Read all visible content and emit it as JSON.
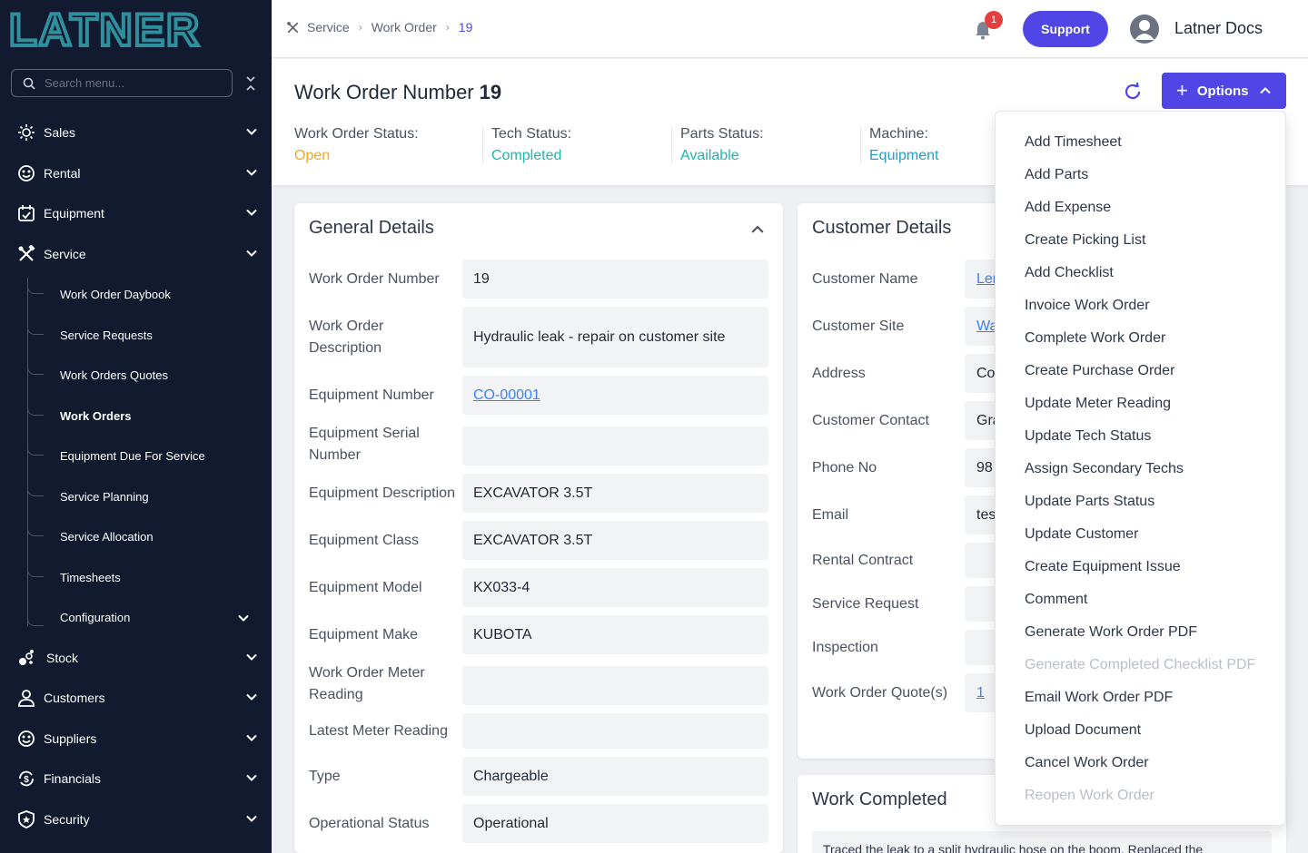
{
  "brand": {
    "logo_text": "LATNER"
  },
  "sidebar": {
    "search_placeholder": "Search menu...",
    "items": [
      {
        "label": "Sales",
        "icon": "sales-icon"
      },
      {
        "label": "Rental",
        "icon": "rental-icon"
      },
      {
        "label": "Equipment",
        "icon": "equipment-icon"
      },
      {
        "label": "Service",
        "icon": "service-icon"
      },
      {
        "label": "Stock",
        "icon": "stock-icon"
      },
      {
        "label": "Customers",
        "icon": "customers-icon"
      },
      {
        "label": "Suppliers",
        "icon": "suppliers-icon"
      },
      {
        "label": "Financials",
        "icon": "financials-icon"
      },
      {
        "label": "Security",
        "icon": "security-icon"
      }
    ],
    "service_sub": [
      "Work Order Daybook",
      "Service Requests",
      "Work Orders Quotes",
      "Work Orders",
      "Equipment Due For Service",
      "Service Planning",
      "Service Allocation",
      "Timesheets",
      "Configuration"
    ]
  },
  "header": {
    "breadcrumb": [
      "Service",
      "Work Order",
      "19"
    ],
    "notification_count": "1",
    "support_label": "Support",
    "user_name": "Latner Docs"
  },
  "page": {
    "title": "Work Order Number",
    "number": "19",
    "statuses": [
      {
        "label": "Work Order Status:",
        "value": "Open",
        "color": "#f5a623"
      },
      {
        "label": "Tech Status:",
        "value": "Completed",
        "color": "#1fb5ad"
      },
      {
        "label": "Parts Status:",
        "value": "Available",
        "color": "#1fb5ad"
      },
      {
        "label": "Machine:",
        "value": "Equipment",
        "color": "#1fa0c8"
      }
    ],
    "options_label": "Options"
  },
  "general": {
    "title": "General Details",
    "rows": [
      {
        "label": "Work Order Number",
        "value": "19"
      },
      {
        "label": "Work Order Description",
        "value": "Hydraulic leak - repair on customer site"
      },
      {
        "label": "Equipment Number",
        "value": "CO-00001"
      },
      {
        "label": "Equipment Serial Number",
        "value": ""
      },
      {
        "label": "Equipment Description",
        "value": "EXCAVATOR 3.5T"
      },
      {
        "label": "Equipment Class",
        "value": "EXCAVATOR 3.5T"
      },
      {
        "label": "Equipment Model",
        "value": "KX033-4"
      },
      {
        "label": "Equipment Make",
        "value": "KUBOTA"
      },
      {
        "label": "Work Order Meter Reading",
        "value": ""
      },
      {
        "label": "Latest Meter Reading",
        "value": ""
      },
      {
        "label": "Type",
        "value": "Chargeable"
      },
      {
        "label": "Operational Status",
        "value": "Operational"
      }
    ]
  },
  "customer": {
    "title": "Customer Details",
    "rows": [
      {
        "label": "Customer Name",
        "value": "Len"
      },
      {
        "label": "Customer Site",
        "value": "Wa"
      },
      {
        "label": "Address",
        "value": "Co"
      },
      {
        "label": "Customer Contact",
        "value": "Gra"
      },
      {
        "label": "Phone No",
        "value": "98"
      },
      {
        "label": "Email",
        "value": "tes"
      },
      {
        "label": "Rental Contract",
        "value": ""
      },
      {
        "label": "Service Request",
        "value": ""
      },
      {
        "label": "Inspection",
        "value": ""
      },
      {
        "label": "Work Order Quote(s)",
        "value": "1"
      }
    ]
  },
  "work_completed": {
    "title": "Work Completed",
    "text": "Traced the leak to a split hydraulic hose on the boom. Replaced the"
  },
  "options_menu": [
    {
      "label": "Add Timesheet",
      "disabled": false
    },
    {
      "label": "Add Parts",
      "disabled": false
    },
    {
      "label": "Add Expense",
      "disabled": false
    },
    {
      "label": "Create Picking List",
      "disabled": false
    },
    {
      "label": "Add Checklist",
      "disabled": false
    },
    {
      "label": "Invoice Work Order",
      "disabled": false
    },
    {
      "label": "Complete Work Order",
      "disabled": false
    },
    {
      "label": "Create Purchase Order",
      "disabled": false
    },
    {
      "label": "Update Meter Reading",
      "disabled": false
    },
    {
      "label": "Update Tech Status",
      "disabled": false
    },
    {
      "label": "Assign Secondary Techs",
      "disabled": false
    },
    {
      "label": "Update Parts Status",
      "disabled": false
    },
    {
      "label": "Update Customer",
      "disabled": false
    },
    {
      "label": "Create Equipment Issue",
      "disabled": false
    },
    {
      "label": "Comment",
      "disabled": false
    },
    {
      "label": "Generate Work Order PDF",
      "disabled": false
    },
    {
      "label": "Generate Completed Checklist PDF",
      "disabled": true
    },
    {
      "label": "Email Work Order PDF",
      "disabled": false
    },
    {
      "label": "Upload Document",
      "disabled": false
    },
    {
      "label": "Cancel Work Order",
      "disabled": false
    },
    {
      "label": "Reopen Work Order",
      "disabled": true
    }
  ]
}
